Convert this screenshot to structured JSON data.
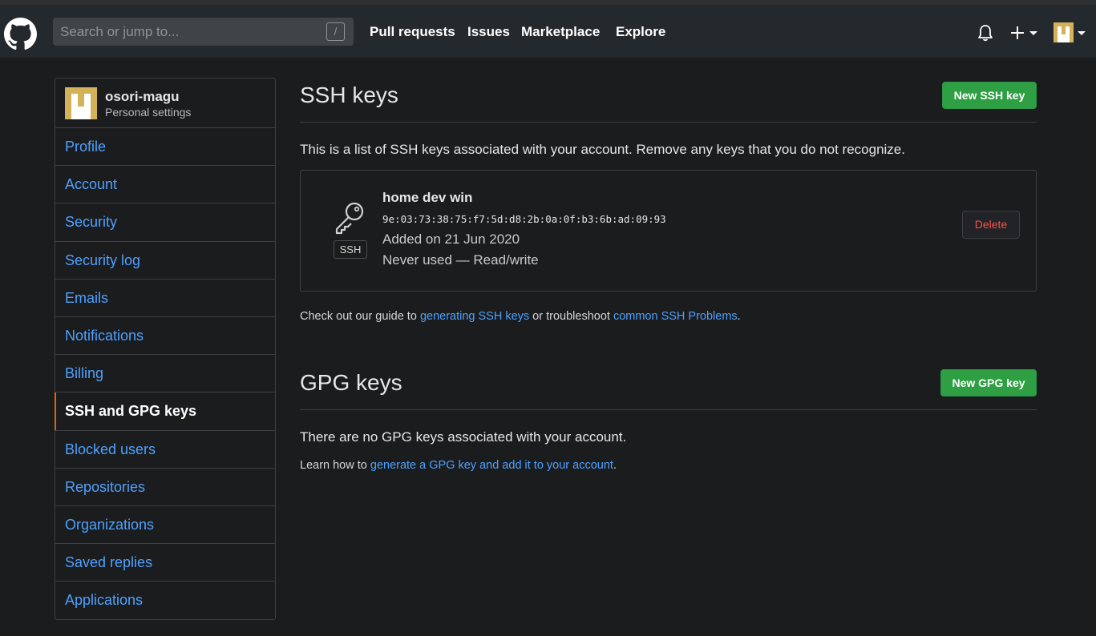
{
  "header": {
    "search_placeholder": "Search or jump to...",
    "search_shortcut": "/",
    "nav": [
      "Pull requests",
      "Issues",
      "Marketplace",
      "Explore"
    ]
  },
  "sidebar": {
    "username": "osori-magu",
    "subtitle": "Personal settings",
    "items": [
      {
        "label": "Profile"
      },
      {
        "label": "Account"
      },
      {
        "label": "Security"
      },
      {
        "label": "Security log"
      },
      {
        "label": "Emails"
      },
      {
        "label": "Notifications"
      },
      {
        "label": "Billing"
      },
      {
        "label": "SSH and GPG keys",
        "active": true
      },
      {
        "label": "Blocked users"
      },
      {
        "label": "Repositories"
      },
      {
        "label": "Organizations"
      },
      {
        "label": "Saved replies"
      },
      {
        "label": "Applications"
      }
    ]
  },
  "ssh": {
    "title": "SSH keys",
    "new_button": "New SSH key",
    "description": "This is a list of SSH keys associated with your account. Remove any keys that you do not recognize.",
    "key": {
      "badge": "SSH",
      "name": "home dev win",
      "fingerprint": "9e:03:73:38:75:f7:5d:d8:2b:0a:0f:b3:6b:ad:09:93",
      "added": "Added on 21 Jun 2020",
      "usage": "Never used — Read/write",
      "delete_label": "Delete"
    },
    "guide_prefix": "Check out our guide to ",
    "guide_link1": "generating SSH keys",
    "guide_middle": " or troubleshoot ",
    "guide_link2": "common SSH Problems",
    "guide_suffix": "."
  },
  "gpg": {
    "title": "GPG keys",
    "new_button": "New GPG key",
    "empty_text": "There are no GPG keys associated with your account.",
    "learn_prefix": "Learn how to ",
    "learn_link": "generate a GPG key and add it to your account",
    "learn_suffix": "."
  },
  "colors": {
    "accent_link": "#4ea1ff",
    "button_green": "#2ea043",
    "danger": "#f85149",
    "active_marker": "#e36209"
  }
}
